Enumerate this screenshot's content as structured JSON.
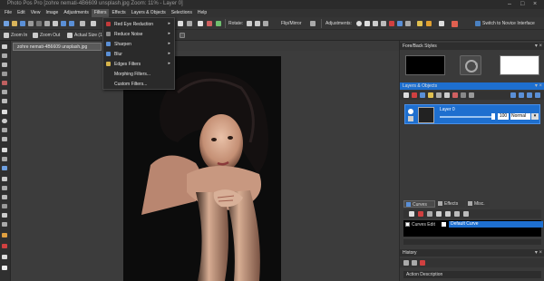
{
  "window": {
    "title": "Photo Pos Pro [zohre nemati-4B6609 unsplash.jpg Zoom: 11% - Layer 0]",
    "controls": [
      "–",
      "□",
      "×"
    ]
  },
  "menu": [
    "File",
    "Edit",
    "View",
    "Image",
    "Adjustments",
    "Filters",
    "Effects",
    "Layers & Objects",
    "Selections",
    "Help"
  ],
  "toolbar1": {
    "rotate_label": "Rotate:",
    "flip_label": "Flip/Mirror",
    "adjustments_label": "Adjustments:",
    "switch_label": "Switch to Novice Interface"
  },
  "toolbar2": {
    "zoom_in": "Zoom In",
    "zoom_out": "Zoom Out",
    "actual_size": "Actual Size (1"
  },
  "doc_tab": "zohre nemati-4B6609 unsplash.jpg",
  "filters_menu": {
    "items": [
      {
        "label": "Red Eye Reduction",
        "submenu": true,
        "icon_color": "#c23a3a"
      },
      {
        "label": "Reduce Noise",
        "submenu": true,
        "icon_color": "#8a8a8a"
      },
      {
        "label": "Sharpen",
        "submenu": true,
        "icon_color": "#5a8fd6"
      },
      {
        "label": "Blur",
        "submenu": true,
        "icon_color": "#5a8fd6"
      },
      {
        "label": "Edges Filters",
        "submenu": true,
        "icon_color": "#d6b34a"
      },
      {
        "label": "Morphing Filters...",
        "submenu": false,
        "icon_color": ""
      },
      {
        "label": "Custom Filters...",
        "submenu": false,
        "icon_color": ""
      }
    ]
  },
  "right_panel": {
    "fore_back_title": "Fore/Back Styles",
    "layers_title": "Layers & Objects",
    "layer_name": "Layer 0",
    "opacity": "100",
    "blend_mode": "Normal",
    "tabs": [
      "Curves",
      "Effects",
      "Misc."
    ],
    "curves_item": "Default Curve",
    "curves_edit": "Curves Edit",
    "history_title": "History",
    "history_item": "Action Description"
  },
  "colors": {
    "accent_blue": "#1e6fcf",
    "panel_bg": "#3a3a3a",
    "menu_bg": "#2a2a2a"
  }
}
